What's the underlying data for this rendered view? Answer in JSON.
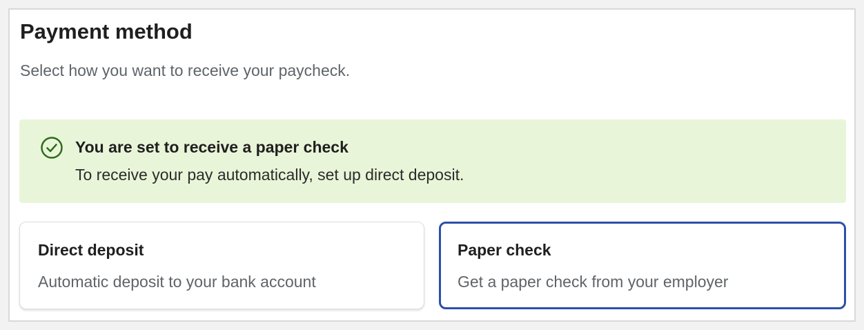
{
  "header": {
    "title": "Payment method",
    "subtitle": "Select how you want to receive your paycheck."
  },
  "alert": {
    "icon": "check-circle-icon",
    "title": "You are set to receive a paper check",
    "body": "To receive your pay automatically, set up direct deposit.",
    "background_color": "#e9f5d8",
    "icon_color": "#2e6b1f"
  },
  "options": [
    {
      "title": "Direct deposit",
      "description": "Automatic deposit to your bank account",
      "selected": false
    },
    {
      "title": "Paper check",
      "description": "Get a paper check from your employer",
      "selected": true
    }
  ],
  "colors": {
    "selected_border": "#2d4fa9",
    "unselected_border": "#dcdcdc"
  }
}
